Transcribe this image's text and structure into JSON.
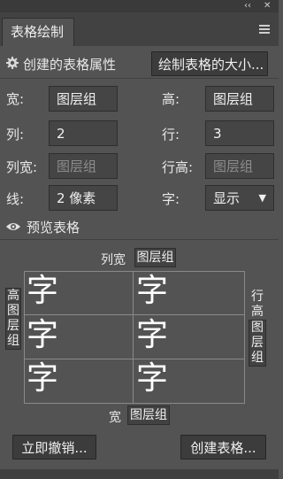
{
  "panel": {
    "tab_title": "表格绘制",
    "collapse_glyph": "‹‹",
    "close_glyph": "✕"
  },
  "create": {
    "section_title": "创建的表格属性",
    "size_button": "绘制表格的大小..."
  },
  "props": {
    "width_label": "宽:",
    "width_value": "图层组",
    "height_label": "高:",
    "height_value": "图层组",
    "cols_label": "列:",
    "cols_value": "2",
    "rows_label": "行:",
    "rows_value": "3",
    "colwidth_label": "列宽:",
    "colwidth_placeholder": "图层组",
    "rowheight_label": "行高:",
    "rowheight_placeholder": "图层组",
    "line_label": "线:",
    "line_value": "2 像素",
    "char_label": "字:",
    "char_value": "显示",
    "char_arrow": "▼"
  },
  "preview": {
    "title": "预览表格",
    "col_width_label": "列宽",
    "col_width_value": "图层组",
    "height_label_chars": [
      "高",
      "图",
      "层",
      "组"
    ],
    "row_label_chars": [
      "行",
      "高",
      "图",
      "层",
      "组"
    ],
    "width_label": "宽",
    "width_value": "图层组",
    "cells": [
      "字",
      "字",
      "字",
      "字",
      "字",
      "字"
    ]
  },
  "actions": {
    "undo": "立即撤销...",
    "create": "创建表格..."
  }
}
